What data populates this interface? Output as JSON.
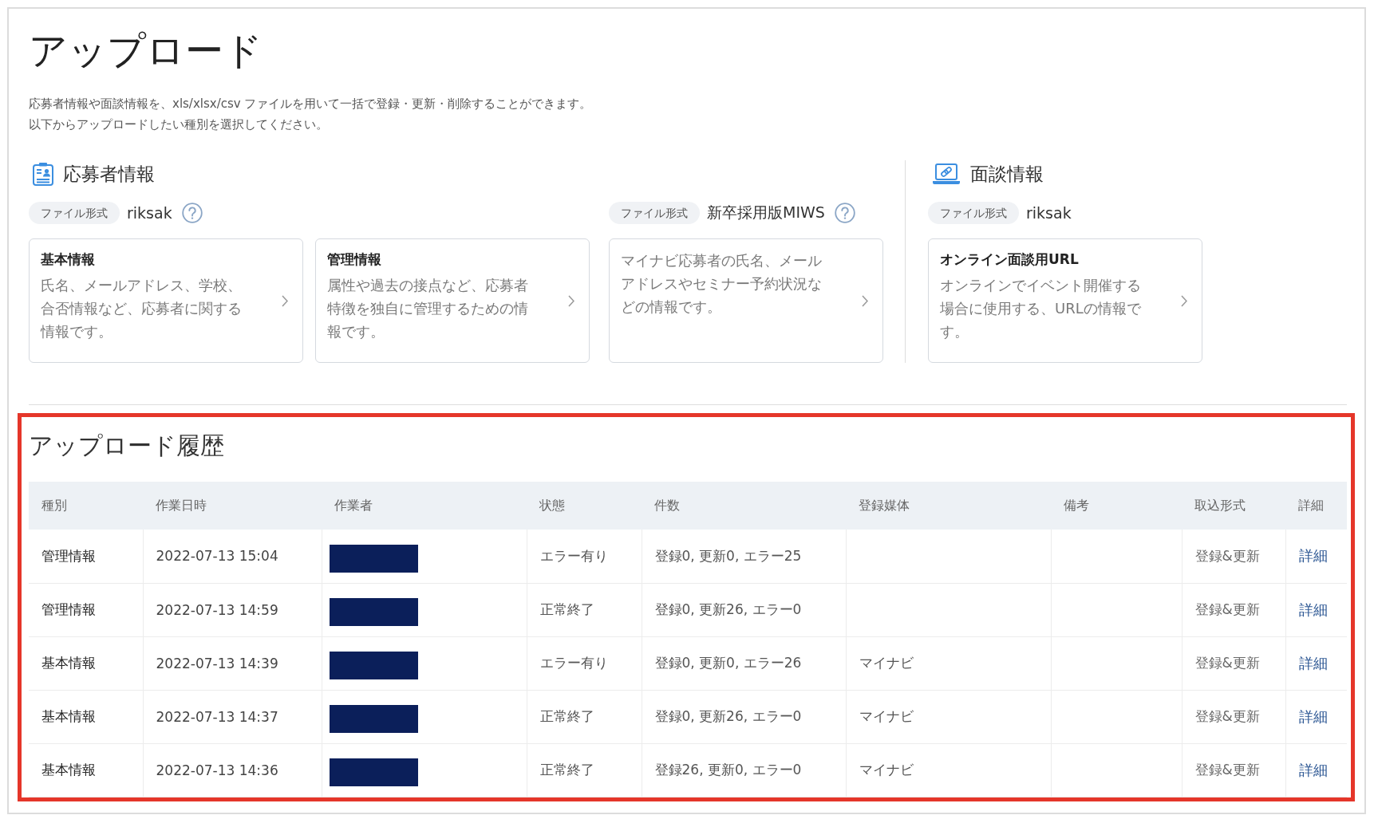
{
  "page": {
    "title": "アップロード",
    "description": [
      "応募者情報や面談情報を、xls/xlsx/csv ファイルを用いて一括で登録・更新・削除することができます。",
      "以下からアップロードしたい種別を選択してください。"
    ]
  },
  "sections": [
    {
      "kind": "applicant",
      "title": "応募者情報",
      "groups": [
        {
          "format_label": "ファイル形式",
          "format": "riksak",
          "help": true,
          "cards": [
            {
              "title": "基本情報",
              "description": "氏名、メールアドレス、学校、合否情報など、応募者に関する情報です。"
            },
            {
              "title": "管理情報",
              "description": "属性や過去の接点など、応募者特徴を独自に管理するための情報です。"
            }
          ]
        },
        {
          "format_label": "ファイル形式",
          "format": "新卒採用版MIWS",
          "help": true,
          "cards": [
            {
              "description": "マイナビ応募者の氏名、メールアドレスやセミナー予約状況などの情報です。"
            }
          ]
        }
      ]
    },
    {
      "kind": "interview",
      "title": "面談情報",
      "groups": [
        {
          "format_label": "ファイル形式",
          "format": "riksak",
          "cards": [
            {
              "title": "オンライン面談用URL",
              "description": "オンラインでイベント開催する場合に使用する、URLの情報です。"
            }
          ]
        }
      ]
    }
  ],
  "history": {
    "highlighted": true,
    "title": "アップロード履歴",
    "table": {
      "columns": [
        "種別",
        "作業日時",
        "作業者",
        "状態",
        "件数",
        "登録媒体",
        "備考",
        "取込形式",
        "詳細"
      ],
      "rows": [
        {
          "type": "管理情報",
          "datetime": "2022-07-13 15:04",
          "worker_redacted": true,
          "status": "エラー有り",
          "count": "登録0, 更新0, エラー25",
          "import_format": "登録&更新",
          "detail": "詳細"
        },
        {
          "type": "管理情報",
          "datetime": "2022-07-13 14:59",
          "worker_redacted": true,
          "status": "正常終了",
          "count": "登録0, 更新26, エラー0",
          "import_format": "登録&更新",
          "detail": "詳細"
        },
        {
          "type": "基本情報",
          "datetime": "2022-07-13 14:39",
          "worker_redacted": true,
          "status": "エラー有り",
          "count": "登録0, 更新0, エラー26",
          "media": "マイナビ",
          "import_format": "登録&更新",
          "detail": "詳細"
        },
        {
          "type": "基本情報",
          "datetime": "2022-07-13 14:37",
          "worker_redacted": true,
          "status": "正常終了",
          "count": "登録0, 更新26, エラー0",
          "media": "マイナビ",
          "import_format": "登録&更新",
          "detail": "詳細"
        },
        {
          "type": "基本情報",
          "datetime": "2022-07-13 14:36",
          "worker_redacted": true,
          "status": "正常終了",
          "count": "登録26, 更新0, エラー0",
          "media": "マイナビ",
          "import_format": "登録&更新",
          "detail": "詳細"
        }
      ]
    }
  }
}
